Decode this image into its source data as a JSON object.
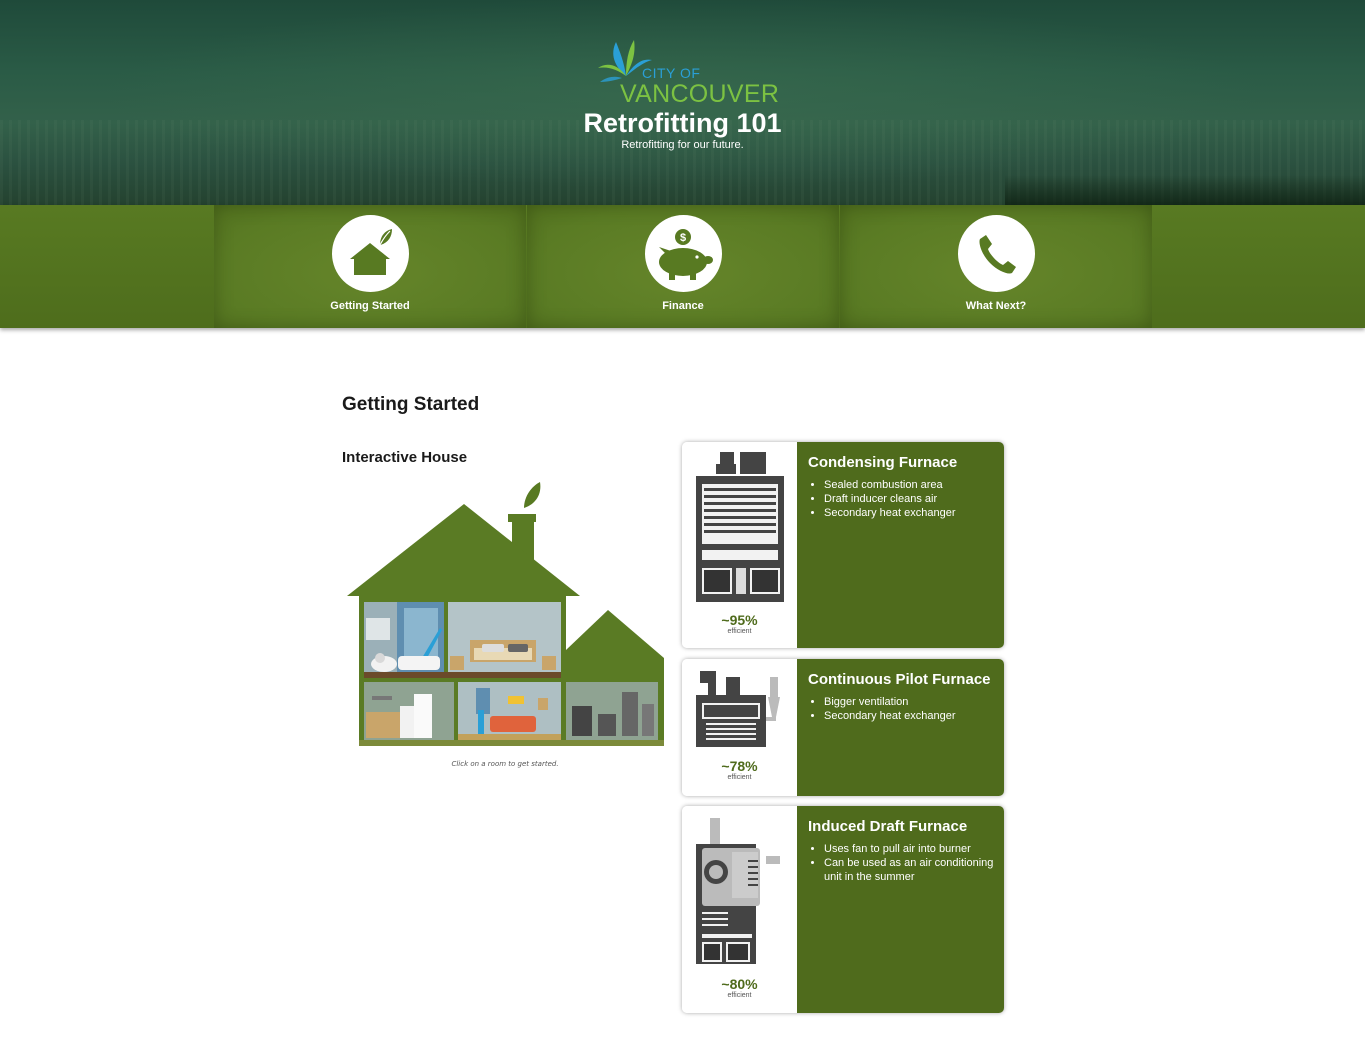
{
  "header": {
    "logo_line1": "CITY OF",
    "logo_line2": "VANCOUVER",
    "title": "Retrofitting 101",
    "subtitle": "Retrofitting for our future."
  },
  "nav": {
    "items": [
      {
        "label": "Getting Started",
        "icon": "house-leaf-icon"
      },
      {
        "label": "Finance",
        "icon": "piggy-bank-icon"
      },
      {
        "label": "What Next?",
        "icon": "phone-icon"
      }
    ]
  },
  "main": {
    "title": "Getting Started",
    "house_title": "Interactive House",
    "house_caption": "Click on a room to get started."
  },
  "furnaces": [
    {
      "title": "Condensing Furnace",
      "bullets": [
        "Sealed combustion area",
        "Draft inducer cleans air",
        "Secondary heat exchanger"
      ],
      "percent": "~95%",
      "efficiency_label": "efficient"
    },
    {
      "title": "Continuous Pilot Furnace",
      "bullets": [
        "Bigger ventilation",
        "Secondary heat exchanger"
      ],
      "percent": "~78%",
      "efficiency_label": "efficient"
    },
    {
      "title": "Induced Draft Furnace",
      "bullets": [
        "Uses fan to pull air into burner",
        "Can be used as an air conditioning unit in the summer"
      ],
      "percent": "~80%",
      "efficiency_label": "efficient"
    }
  ],
  "colors": {
    "nav_green": "#587a22",
    "card_green": "#4f6b1c",
    "logo_blue": "#2a9fd6",
    "logo_green": "#7cc242"
  }
}
